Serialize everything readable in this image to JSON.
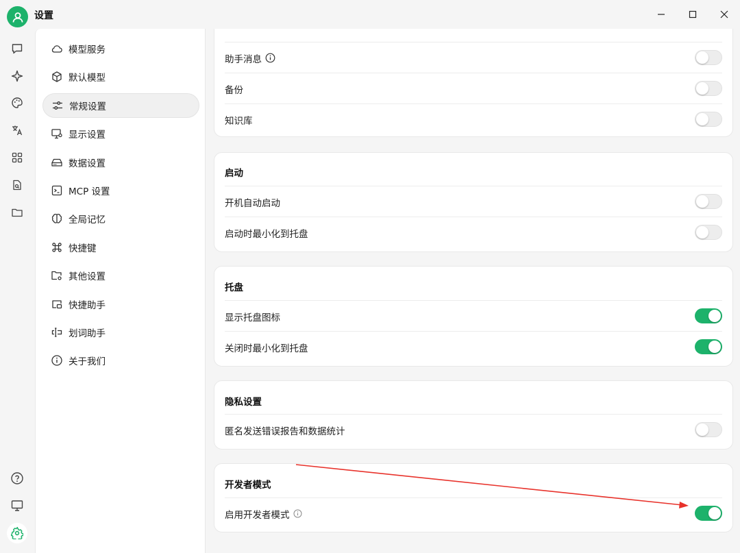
{
  "window": {
    "title": "设置"
  },
  "leftbar": {
    "icons": [
      "chat-icon",
      "sparkle-icon",
      "palette-icon",
      "translate-icon",
      "apps-grid-icon",
      "file-search-icon",
      "folder-icon",
      "help-icon",
      "monitor-icon",
      "settings-gear-icon"
    ],
    "active": "settings-gear-icon"
  },
  "sidebar": {
    "items": [
      {
        "label": "模型服务",
        "icon": "cloud-icon"
      },
      {
        "label": "默认模型",
        "icon": "cube-icon"
      },
      {
        "label": "常规设置",
        "icon": "sliders-icon",
        "active": true
      },
      {
        "label": "显示设置",
        "icon": "display-settings-icon"
      },
      {
        "label": "数据设置",
        "icon": "hard-drive-icon"
      },
      {
        "label": "MCP 设置",
        "icon": "terminal-icon"
      },
      {
        "label": "全局记忆",
        "icon": "brain-icon"
      },
      {
        "label": "快捷键",
        "icon": "command-icon"
      },
      {
        "label": "其他设置",
        "icon": "folder-cog-icon"
      },
      {
        "label": "快捷助手",
        "icon": "window-assistant-icon"
      },
      {
        "label": "划词助手",
        "icon": "text-cursor-icon"
      },
      {
        "label": "关于我们",
        "icon": "info-icon"
      }
    ]
  },
  "sections": {
    "top": {
      "rows": [
        {
          "label": "助手消息",
          "info": true,
          "on": false
        },
        {
          "label": "备份",
          "on": false
        },
        {
          "label": "知识库",
          "on": false
        }
      ]
    },
    "startup": {
      "title": "启动",
      "rows": [
        {
          "label": "开机自动启动",
          "on": false
        },
        {
          "label": "启动时最小化到托盘",
          "on": false
        }
      ]
    },
    "tray": {
      "title": "托盘",
      "rows": [
        {
          "label": "显示托盘图标",
          "on": true
        },
        {
          "label": "关闭时最小化到托盘",
          "on": true
        }
      ]
    },
    "privacy": {
      "title": "隐私设置",
      "rows": [
        {
          "label": "匿名发送错误报告和数据统计",
          "on": false
        }
      ]
    },
    "developer": {
      "title": "开发者模式",
      "rows": [
        {
          "label": "启用开发者模式",
          "info": true,
          "on": true
        }
      ]
    }
  },
  "colors": {
    "accent": "#1db26b",
    "annotation_arrow": "#e8322b"
  }
}
